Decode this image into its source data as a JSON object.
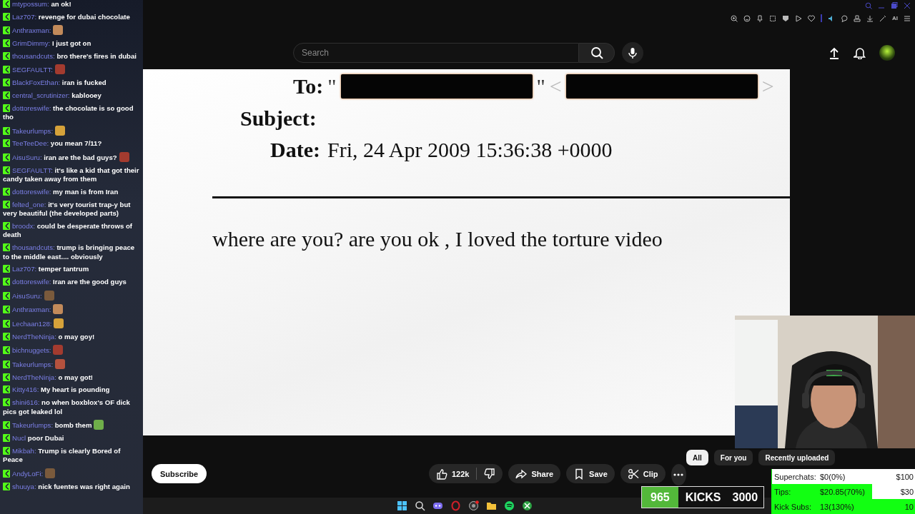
{
  "browser": {
    "ai_label": "AI"
  },
  "search": {
    "placeholder": "Search"
  },
  "document": {
    "to_label": "To:",
    "recipients": [
      {
        "open": "\"",
        "close": "\""
      },
      {
        "open": "<",
        "close": ">"
      }
    ],
    "subject_label": "Subject:",
    "date_label": "Date:",
    "date": "Fri, 24 Apr 2009 15:36:38 +0000",
    "body": "where are you? are you ok , I loved the torture video"
  },
  "channel": {
    "subscribe": "Subscribe"
  },
  "actions": {
    "likes": "122k",
    "share": "Share",
    "save": "Save",
    "clip": "Clip"
  },
  "chips": [
    {
      "label": "All",
      "selected": true
    },
    {
      "label": "For you",
      "selected": false
    },
    {
      "label": "Recently uploaded",
      "selected": false
    }
  ],
  "chat": [
    {
      "user": "mtypossum:",
      "text": "an ok!",
      "emote": false
    },
    {
      "user": "Laz707:",
      "text": "revenge for dubai chocolate",
      "emote": false
    },
    {
      "user": "Anthraxman:",
      "emote": true
    },
    {
      "user": "GrimDimmy:",
      "text": "I just got on",
      "emote": false
    },
    {
      "user": "thousandcuts:",
      "text": "bro there's fires in dubai",
      "emote": false
    },
    {
      "user": "SEGFAULTT:",
      "emote": true
    },
    {
      "user": "BlackFoxEthan:",
      "text": "iran is fucked",
      "emote": false
    },
    {
      "user": "central_scrutinizer:",
      "text": "kablooey",
      "emote": false
    },
    {
      "user": "dottoreswife:",
      "text": "the chocolate is so good tho",
      "emote": false
    },
    {
      "user": "Takeurlumps:",
      "emote": true
    },
    {
      "user": "TeeTeeDee:",
      "text": "you mean 7/11?",
      "emote": false
    },
    {
      "user": "AisuSuru:",
      "text": "iran are the bad guys?",
      "emote": true
    },
    {
      "user": "SEGFAULTT:",
      "text": "it's like a kid that got their candy taken away from them",
      "emote": false
    },
    {
      "user": "dottoreswife:",
      "text": "my man is from Iran",
      "emote": false
    },
    {
      "user": "felted_one:",
      "text": "it's very tourist trap-y but very beautiful (the developed parts)",
      "emote": false
    },
    {
      "user": "broodx:",
      "text": "could be desperate throws of death",
      "emote": false
    },
    {
      "user": "thousandcuts:",
      "text": "trump is bringing peace to the middle east.... obviously",
      "emote": false
    },
    {
      "user": "Laz707:",
      "text": "temper tantrum",
      "emote": false
    },
    {
      "user": "dottoreswife:",
      "text": "Iran are the good guys",
      "emote": false
    },
    {
      "user": "AisuSuru:",
      "emote": true
    },
    {
      "user": "Anthraxman:",
      "emote": true
    },
    {
      "user": "Lechaan128:",
      "emote": true
    },
    {
      "user": "NerdTheNinja:",
      "text": "o may goy!",
      "emote": false
    },
    {
      "user": "bichnuggets:",
      "emote": true
    },
    {
      "user": "Takeurlumps:",
      "emote": true
    },
    {
      "user": "NerdTheNinja:",
      "text": "o may got!",
      "emote": false
    },
    {
      "user": "Kitty416:",
      "text": "My heart is pounding",
      "emote": false
    },
    {
      "user": "shini616:",
      "text": "no when boxblox's OF dick pics got leaked lol",
      "emote": false
    },
    {
      "user": "Takeurlumps:",
      "text": "bomb them",
      "emote": true
    },
    {
      "user": "Nucl",
      "text": "poor Dubai",
      "emote": false
    },
    {
      "user": "Mikbah:",
      "text": "Trump is clearly Bored of Peace",
      "emote": false
    },
    {
      "user": "AndyLoFi:",
      "emote": true
    },
    {
      "user": "shuuya:",
      "text": "nick fuentes was right again",
      "emote": false
    }
  ],
  "kicks": {
    "count": "965",
    "label": "KICKS",
    "goal": "3000"
  },
  "goals": [
    {
      "label": "Superchats:",
      "current": "$0(0%)",
      "goal": "$100",
      "level": 0
    },
    {
      "label": "Tips:",
      "current": "$20.85(70%)",
      "goal": "$30",
      "level": 0.7
    },
    {
      "label": "Kick Subs:",
      "current": "13(130%)",
      "goal": "10",
      "level": 1
    }
  ]
}
